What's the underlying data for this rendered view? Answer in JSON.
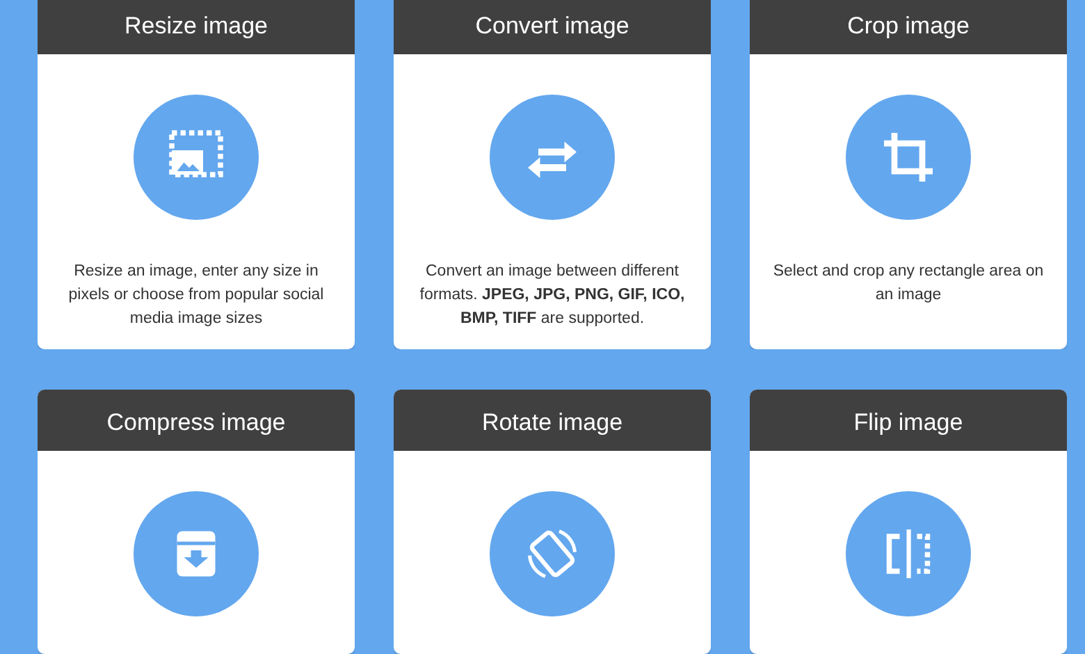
{
  "tools": [
    {
      "title": "Resize image",
      "kind": "resize",
      "description": "Resize an image, enter any size in pixels or choose from popular social media image sizes"
    },
    {
      "title": "Convert image",
      "kind": "convert",
      "description": "Convert an image between different formats. **JPEG, JPG, PNG, GIF, ICO, BMP, TIFF** are supported."
    },
    {
      "title": "Crop image",
      "kind": "crop",
      "description": "Select and crop any rectangle area on an image"
    },
    {
      "title": "Compress image",
      "kind": "compress"
    },
    {
      "title": "Rotate image",
      "kind": "rotate"
    },
    {
      "title": "Flip image",
      "kind": "flip"
    }
  ]
}
